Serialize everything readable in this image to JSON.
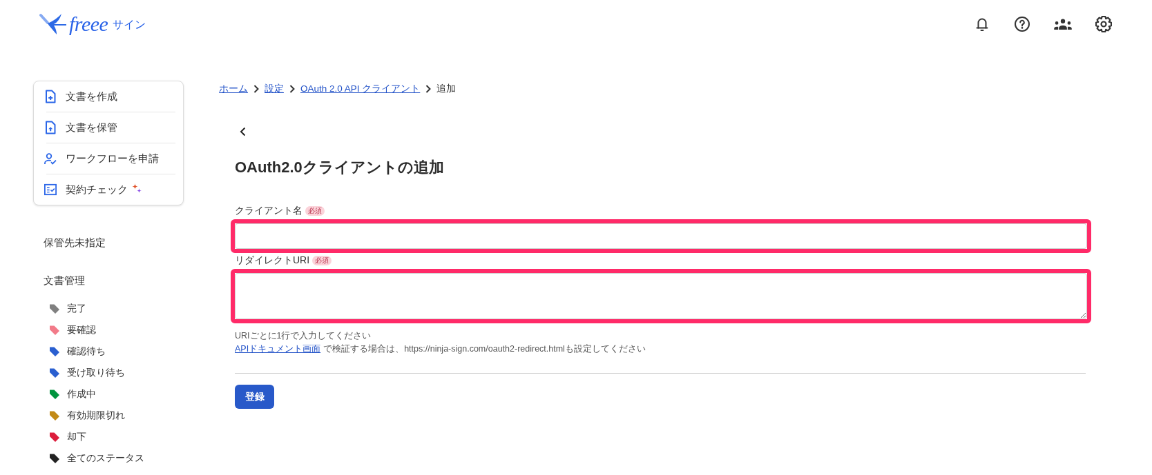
{
  "header": {
    "logo": {
      "wordmark": "freee",
      "product": "サイン"
    }
  },
  "sidebar": {
    "actions": [
      {
        "label": "文書を作成",
        "kind": "create",
        "sparkle": false
      },
      {
        "label": "文書を保管",
        "kind": "store",
        "sparkle": false
      },
      {
        "label": "ワークフローを申請",
        "kind": "workflow",
        "sparkle": false
      },
      {
        "label": "契約チェック",
        "kind": "review",
        "sparkle": true
      }
    ],
    "unassigned": "保管先未指定",
    "document_section": {
      "title": "文書管理",
      "statuses": [
        {
          "label": "完了",
          "color": "#808080"
        },
        {
          "label": "要確認",
          "color": "#f27b89"
        },
        {
          "label": "確認待ち",
          "color": "#2a5fd0"
        },
        {
          "label": "受け取り待ち",
          "color": "#2a5fd0"
        },
        {
          "label": "作成中",
          "color": "#00943e"
        },
        {
          "label": "有効期限切れ",
          "color": "#c28a17"
        },
        {
          "label": "却下",
          "color": "#dc1d3c"
        },
        {
          "label": "全てのステータス",
          "color": "#222222"
        }
      ]
    }
  },
  "main": {
    "breadcrumb": [
      {
        "label": "ホーム",
        "link": true
      },
      {
        "label": "設定",
        "link": true
      },
      {
        "label": "OAuth 2.0 API クライアント",
        "link": true
      },
      {
        "label": "追加",
        "link": false
      }
    ],
    "title": "OAuth2.0クライアントの追加",
    "fields": [
      {
        "label": "クライアント名",
        "badge": "必須",
        "kind": "input",
        "highlighted": true
      },
      {
        "label": "リダイレクトURI",
        "badge": "必須",
        "kind": "textarea",
        "highlighted": true
      }
    ],
    "hint": "URIごとに1行で入力してください",
    "note": {
      "link": "APIドキュメント画面",
      "text": "で検証する場合は、https://ninja-sign.com/oauth2-redirect.htmlも設定してください"
    },
    "submit": "登録"
  }
}
